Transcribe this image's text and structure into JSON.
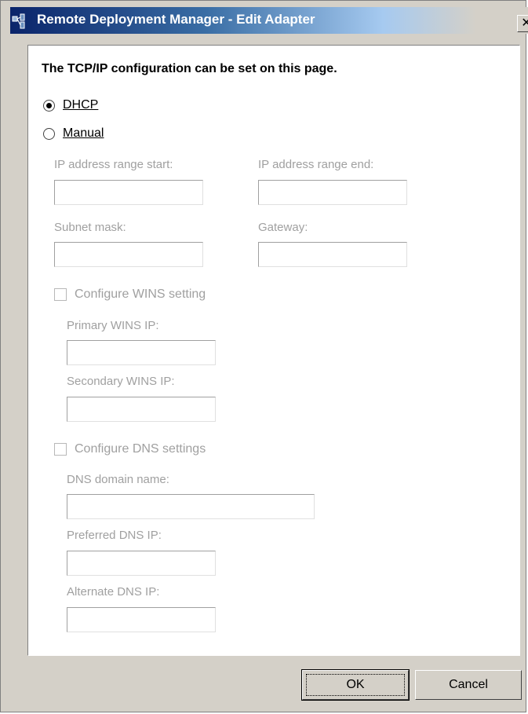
{
  "window": {
    "title": "Remote Deployment Manager - Edit Adapter",
    "close_glyph": "✕"
  },
  "content": {
    "heading": "The TCP/IP configuration can be set on this page."
  },
  "mode": {
    "selected": "DHCP",
    "dhcp_label": "DHCP",
    "manual_label": "Manual"
  },
  "ip": {
    "range_start_label": "IP address range start:",
    "range_start_value": "",
    "range_end_label": "IP address range end:",
    "range_end_value": "",
    "subnet_label": "Subnet mask:",
    "subnet_value": "",
    "gateway_label": "Gateway:",
    "gateway_value": ""
  },
  "wins": {
    "checkbox_label": "Configure WINS setting",
    "checked": false,
    "primary_label": "Primary WINS IP:",
    "primary_value": "",
    "secondary_label": "Secondary WINS IP:",
    "secondary_value": ""
  },
  "dns": {
    "checkbox_label": "Configure DNS settings",
    "checked": false,
    "domain_label": "DNS domain name:",
    "domain_value": "",
    "preferred_label": "Preferred DNS IP:",
    "preferred_value": "",
    "alternate_label": "Alternate DNS IP:",
    "alternate_value": ""
  },
  "buttons": {
    "ok": "OK",
    "cancel": "Cancel"
  }
}
